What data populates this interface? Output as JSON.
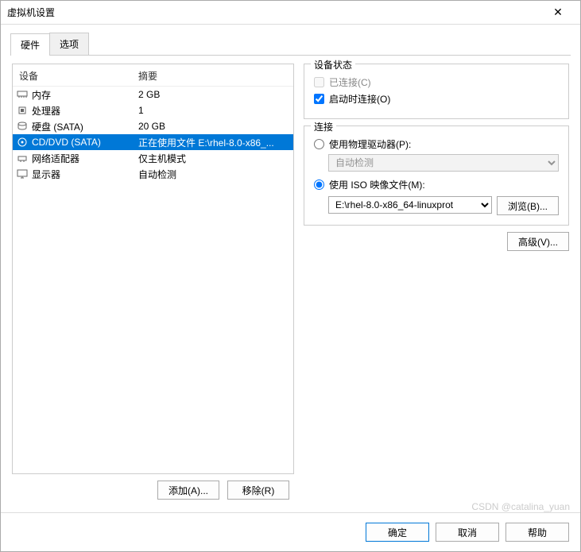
{
  "window": {
    "title": "虚拟机设置"
  },
  "tabs": {
    "hardware": "硬件",
    "options": "选项"
  },
  "listHeader": {
    "device": "设备",
    "summary": "摘要"
  },
  "devices": [
    {
      "icon": "memory",
      "name": "内存",
      "summary": "2 GB"
    },
    {
      "icon": "cpu",
      "name": "处理器",
      "summary": "1"
    },
    {
      "icon": "disk",
      "name": "硬盘 (SATA)",
      "summary": "20 GB"
    },
    {
      "icon": "cd",
      "name": "CD/DVD (SATA)",
      "summary": "正在使用文件 E:\\rhel-8.0-x86_..."
    },
    {
      "icon": "net",
      "name": "网络适配器",
      "summary": "仅主机模式"
    },
    {
      "icon": "display",
      "name": "显示器",
      "summary": "自动检测"
    }
  ],
  "selectedIndex": 3,
  "leftButtons": {
    "add": "添加(A)...",
    "remove": "移除(R)"
  },
  "status": {
    "title": "设备状态",
    "connected": "已连接(C)",
    "connectAtPowerOn": "启动时连接(O)"
  },
  "connection": {
    "title": "连接",
    "usePhysical": "使用物理驱动器(P):",
    "autoDetect": "自动检测",
    "useIso": "使用 ISO 映像文件(M):",
    "isoPath": "E:\\rhel-8.0-x86_64-linuxprot",
    "browse": "浏览(B)..."
  },
  "advanced": "高级(V)...",
  "footer": {
    "ok": "确定",
    "cancel": "取消",
    "help": "帮助"
  },
  "watermark": "CSDN @catalina_yuan"
}
